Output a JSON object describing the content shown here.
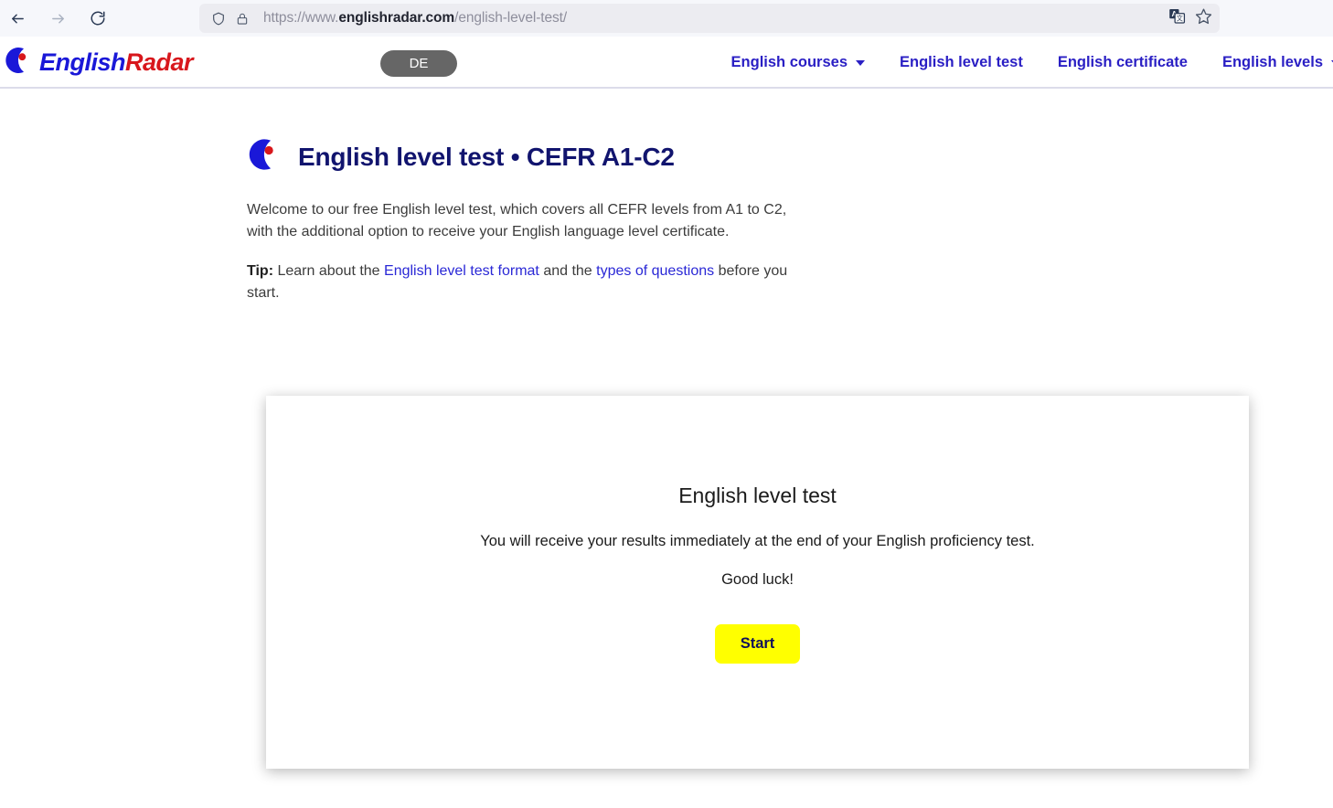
{
  "browser": {
    "back_icon": "back-arrow-icon",
    "forward_icon": "forward-arrow-icon",
    "reload_icon": "reload-icon",
    "shield_icon": "shield-icon",
    "lock_icon": "lock-icon",
    "translate_icon": "translate-icon",
    "bookmark_icon": "star-bookmark-icon",
    "url": {
      "scheme": "https://www.",
      "domain": "englishradar.com",
      "path": "/english-level-test/",
      "full": "https://www.englishradar.com/english-level-test/"
    }
  },
  "header": {
    "logo": {
      "icon": "crescent-dot-logo-icon",
      "word_one": "English",
      "word_two": "Radar",
      "color_blue": "#1a18d8",
      "color_red": "#d8171c"
    },
    "language_button": {
      "label": "DE",
      "background": "#666666"
    },
    "nav": [
      {
        "label": "English courses",
        "has_dropdown": true
      },
      {
        "label": "English level test",
        "has_dropdown": false
      },
      {
        "label": "English certificate",
        "has_dropdown": false
      },
      {
        "label": "English levels",
        "has_dropdown": true
      }
    ],
    "nav_color": "#2a1fc4"
  },
  "main": {
    "heading": {
      "icon": "crescent-dot-logo-icon",
      "text": "English level test • CEFR A1-C2",
      "color": "#11146e"
    },
    "paragraph_1": "Welcome to our free English level test, which covers all CEFR levels from A1 to C2, with the additional option to receive your English language level certificate.",
    "tip": {
      "label": "Tip:",
      "before_link_1": " Learn about the ",
      "link_1": "English level test format",
      "between_links": " and the ",
      "link_2": "types of questions",
      "after_link_2": " before you start.",
      "link_color": "#2a28d6"
    }
  },
  "card": {
    "title": "English level test",
    "subtitle": "You will receive your results immediately at the end of your English proficiency test.",
    "good_luck": "Good luck!",
    "start_button": {
      "label": "Start",
      "background": "#ffff00",
      "text_color": "#10105a"
    }
  }
}
